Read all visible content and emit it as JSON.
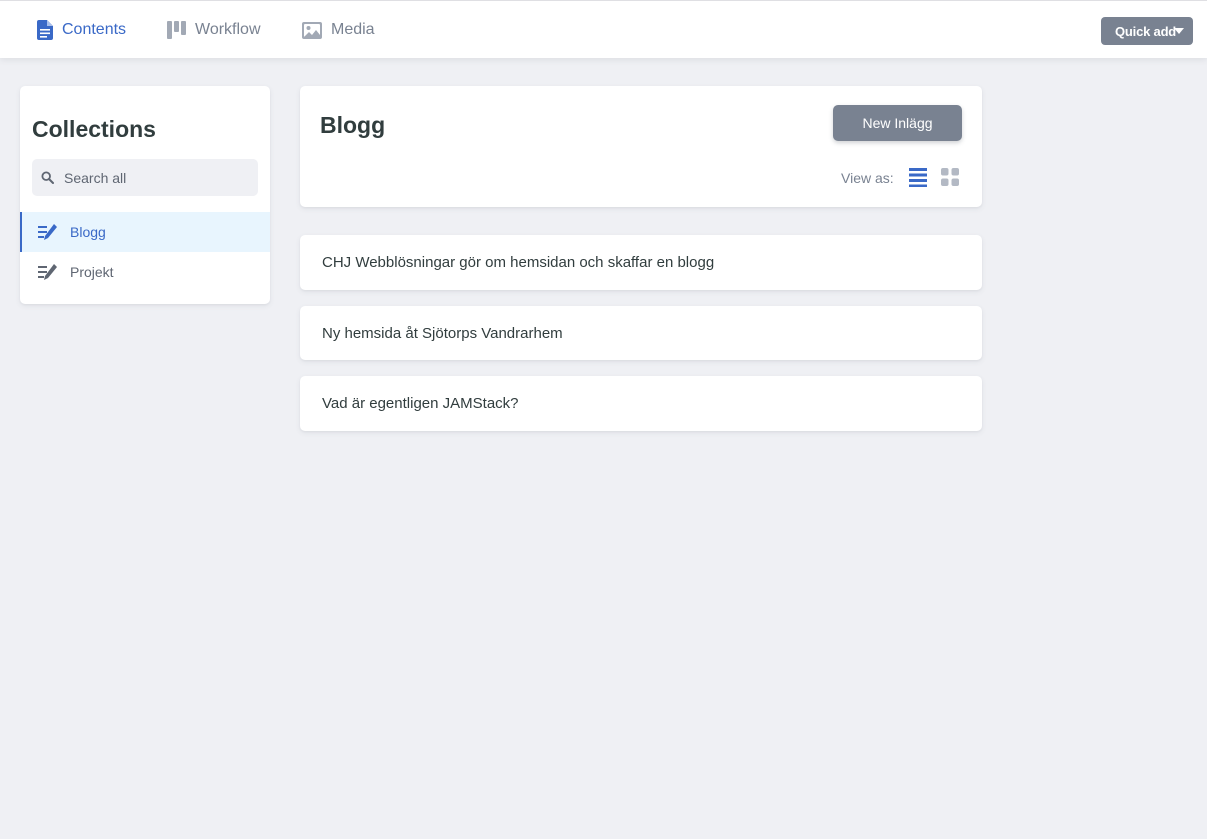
{
  "topbar": {
    "nav": [
      {
        "label": "Contents",
        "icon": "document-icon",
        "active": true
      },
      {
        "label": "Workflow",
        "icon": "kanban-icon",
        "active": false
      },
      {
        "label": "Media",
        "icon": "image-icon",
        "active": false
      }
    ],
    "quick_add_label": "Quick add"
  },
  "sidebar": {
    "title": "Collections",
    "search_placeholder": "Search all",
    "collections": [
      {
        "label": "Blogg",
        "icon": "edit-list-icon",
        "active": true
      },
      {
        "label": "Projekt",
        "icon": "edit-list-icon",
        "active": false
      }
    ]
  },
  "main": {
    "collection_title": "Blogg",
    "new_button_label": "New Inlägg",
    "view_as_label": "View as:",
    "entries": [
      "CHJ Webblösningar gör om hemsidan och skaffar en blogg",
      "Ny hemsida åt Sjötorps Vandrarhem",
      "Vad är egentligen JAMStack?"
    ]
  },
  "colors": {
    "accent": "#3a69c7",
    "muted": "#798291",
    "background": "#eff0f4",
    "active_bg": "#e8f5fe"
  }
}
